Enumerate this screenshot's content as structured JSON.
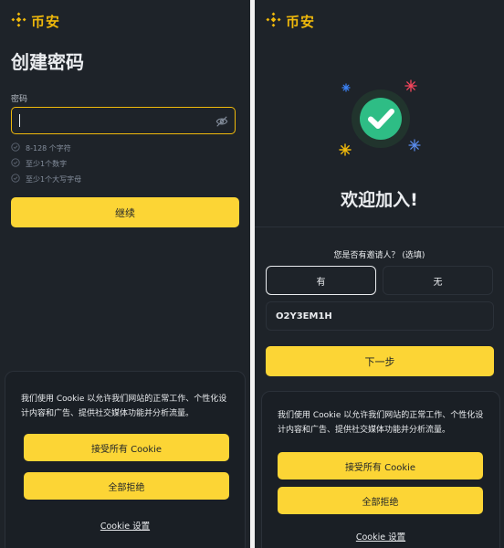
{
  "brand": {
    "name": "币安",
    "color": "#f0b90b"
  },
  "create_password": {
    "title": "创建密码",
    "password_label": "密码",
    "password_value": "",
    "rules": [
      "8-128 个字符",
      "至少1个数字",
      "至少1个大写字母"
    ],
    "continue_label": "继续"
  },
  "welcome": {
    "title": "欢迎加入!",
    "referral_question": "您是否有邀请人？ (选填)",
    "yes_label": "有",
    "no_label": "无",
    "referral_code": "O2Y3EM1H",
    "next_label": "下一步"
  },
  "cookie": {
    "text": "我们使用 Cookie 以允许我们网站的正常工作、个性化设计内容和广告、提供社交媒体功能并分析流量。",
    "accept_label": "接受所有 Cookie",
    "reject_label": "全部拒绝",
    "settings_label": "Cookie 设置"
  },
  "icons": {
    "logo": "binance-logo-icon",
    "eye": "eye-off-icon",
    "check": "check-circle-icon",
    "success": "success-check-icon"
  },
  "colors": {
    "background": "#1e2329",
    "accent_yellow": "#fcd535",
    "success_green": "#2ebd85",
    "muted_text": "#848e9c"
  }
}
